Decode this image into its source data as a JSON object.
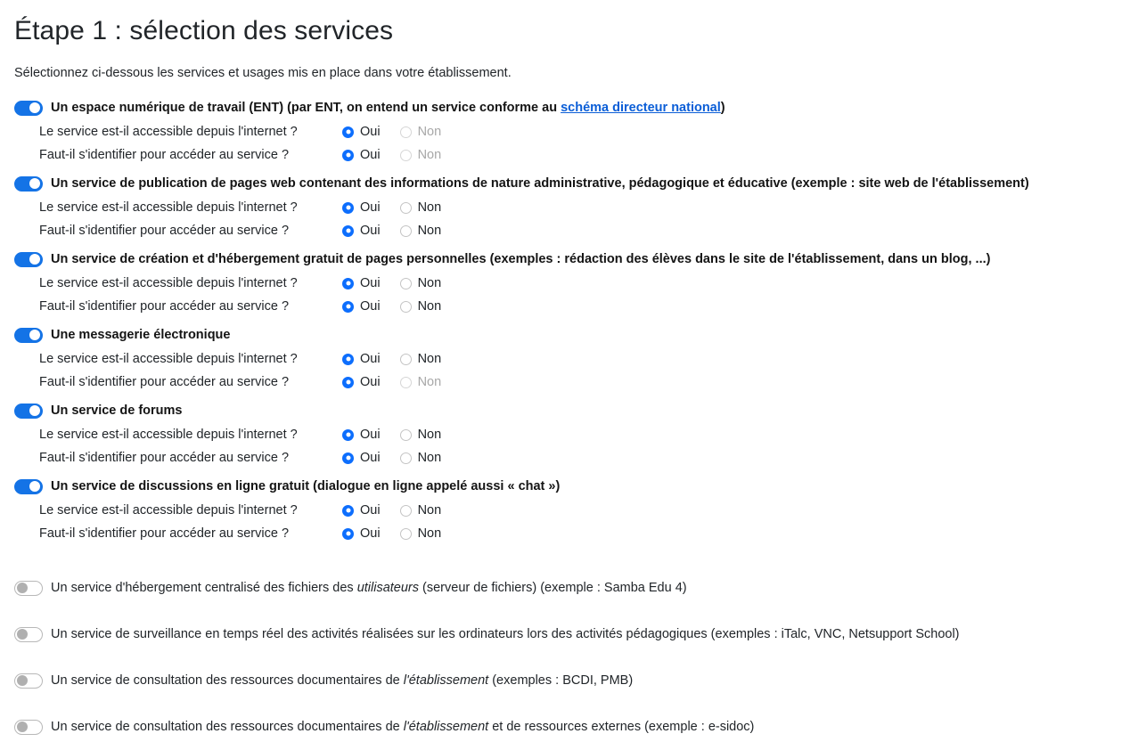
{
  "page": {
    "title": "Étape 1 : sélection des services",
    "intro": "Sélectionnez ci-dessous les services et usages mis en place dans votre établissement."
  },
  "questions": {
    "internet": "Le service est-il accessible depuis l'internet ?",
    "identify": "Faut-il s'identifier pour accéder au service ?",
    "yes": "Oui",
    "no": "Non"
  },
  "colors": {
    "toggle_on": "#1473e6",
    "radio_checked": "#0d6efd",
    "link": "#0b5ed7",
    "disabled_text": "#a8a8a8"
  },
  "services": [
    {
      "toggle": "on",
      "label_before_link": "Un espace numérique de travail (ENT) (par ENT, on entend un service conforme au ",
      "link_text": "schéma directeur national",
      "label_after_link": ")",
      "rows": [
        {
          "question": "internet",
          "selected": "oui",
          "no_disabled": true
        },
        {
          "question": "identify",
          "selected": "oui",
          "no_disabled": true
        }
      ]
    },
    {
      "toggle": "on",
      "label": "Un service de publication de pages web contenant des informations de nature administrative, pédagogique et éducative (exemple : site web de l'établissement)",
      "rows": [
        {
          "question": "internet",
          "selected": "oui",
          "no_disabled": false
        },
        {
          "question": "identify",
          "selected": "oui",
          "no_disabled": false
        }
      ]
    },
    {
      "toggle": "on",
      "label": "Un service de création et d'hébergement gratuit de pages personnelles (exemples : rédaction des élèves dans le site de l'établissement, dans un blog, ...)",
      "rows": [
        {
          "question": "internet",
          "selected": "oui",
          "no_disabled": false
        },
        {
          "question": "identify",
          "selected": "oui",
          "no_disabled": false
        }
      ]
    },
    {
      "toggle": "on",
      "label": "Une messagerie électronique",
      "rows": [
        {
          "question": "internet",
          "selected": "oui",
          "no_disabled": false
        },
        {
          "question": "identify",
          "selected": "oui",
          "no_disabled": true
        }
      ]
    },
    {
      "toggle": "on",
      "label": "Un service de forums",
      "rows": [
        {
          "question": "internet",
          "selected": "oui",
          "no_disabled": false
        },
        {
          "question": "identify",
          "selected": "oui",
          "no_disabled": false
        }
      ]
    },
    {
      "toggle": "on",
      "label": "Un service de discussions en ligne gratuit (dialogue en ligne appelé aussi « chat »)",
      "rows": [
        {
          "question": "internet",
          "selected": "oui",
          "no_disabled": false
        },
        {
          "question": "identify",
          "selected": "oui",
          "no_disabled": false
        }
      ]
    }
  ],
  "plain_services": [
    {
      "toggle": "off",
      "parts": [
        {
          "text": "Un service d'hébergement centralisé des fichiers des ",
          "italic": false
        },
        {
          "text": "utilisateurs",
          "italic": true
        },
        {
          "text": " (serveur de fichiers) (exemple : Samba Edu 4)",
          "italic": false
        }
      ]
    },
    {
      "toggle": "off",
      "parts": [
        {
          "text": "Un service de surveillance en temps réel des activités réalisées sur les ordinateurs lors des activités pédagogiques (exemples : iTalc, VNC, Netsupport School)",
          "italic": false
        }
      ]
    },
    {
      "toggle": "off",
      "parts": [
        {
          "text": "Un service de consultation des ressources documentaires de ",
          "italic": false
        },
        {
          "text": "l'établissement",
          "italic": true
        },
        {
          "text": " (exemples : BCDI, PMB)",
          "italic": false
        }
      ]
    },
    {
      "toggle": "off",
      "parts": [
        {
          "text": "Un service de consultation des ressources documentaires de ",
          "italic": false
        },
        {
          "text": "l'établissement",
          "italic": true
        },
        {
          "text": " et de ressources externes (exemple : e-sidoc)",
          "italic": false
        }
      ]
    }
  ]
}
